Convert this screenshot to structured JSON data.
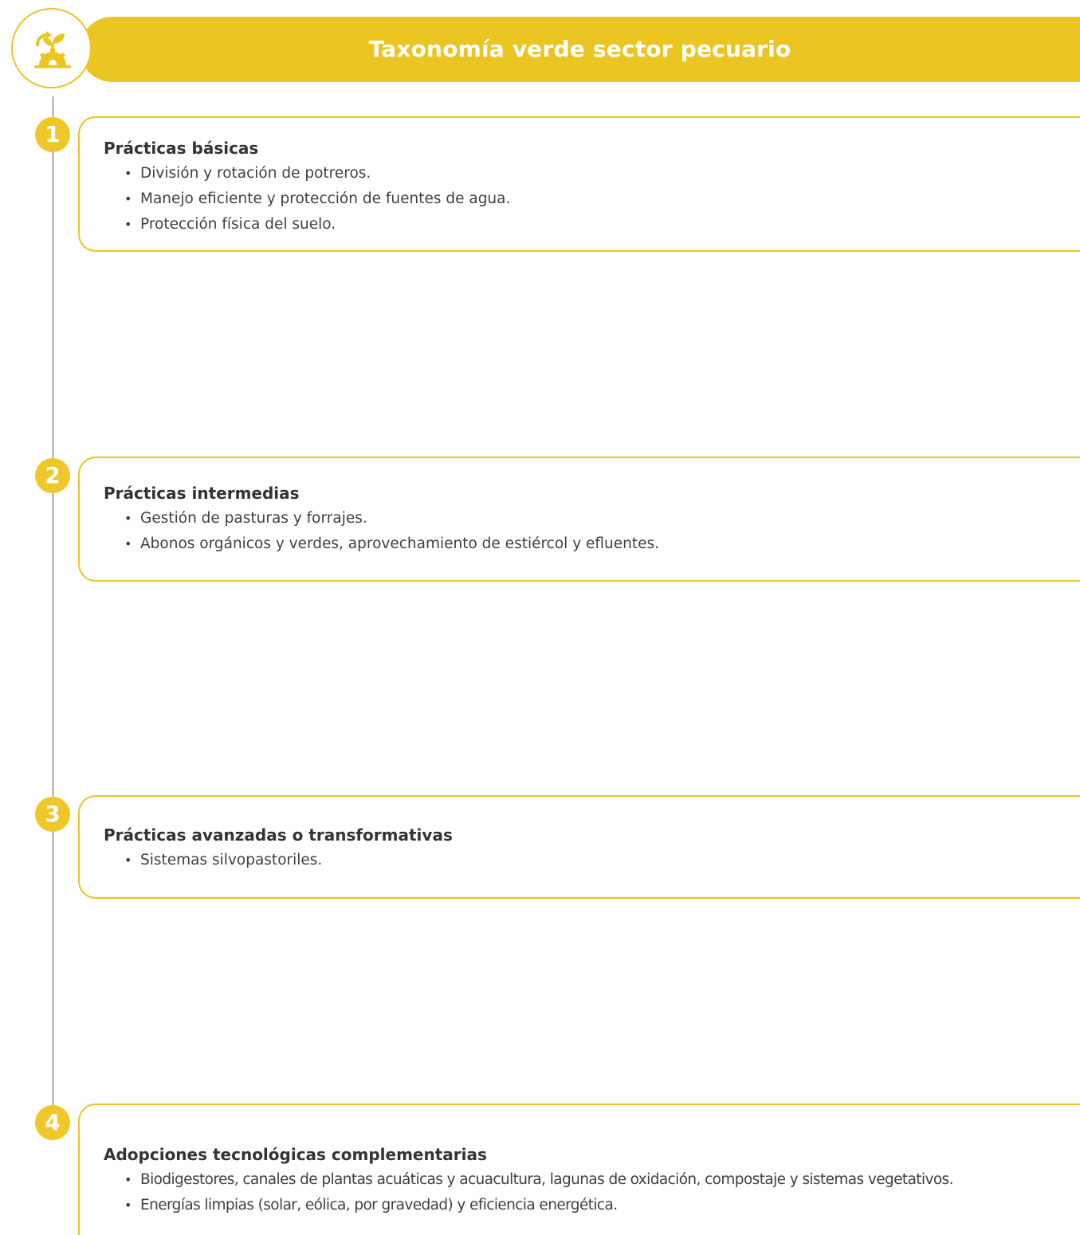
{
  "header": {
    "title": "Taxonomía verde sector pecuario"
  },
  "colors": {
    "accent": "#ebc522",
    "text": "#3f3f3f",
    "line": "#5c5c5c"
  },
  "steps": [
    {
      "number": "1",
      "title": "Prácticas básicas",
      "items": [
        "División y rotación de potreros.",
        "Manejo eficiente y protección de fuentes de agua.",
        "Protección física del suelo."
      ]
    },
    {
      "number": "2",
      "title": "Prácticas intermedias",
      "items": [
        "Gestión de pasturas y forrajes.",
        "Abonos orgánicos y verdes, aprovechamiento de estiércol y efluentes."
      ]
    },
    {
      "number": "3",
      "title": "Prácticas avanzadas o transformativas",
      "items": [
        "Sistemas silvopastoriles."
      ]
    },
    {
      "number": "4",
      "title": "Adopciones tecnológicas complementarias",
      "items": [
        "Biodigestores, canales de plantas acuáticas y acuacultura, lagunas de oxidación, compostaje y sistemas vegetativos.",
        "Energías limpias (solar, eólica, por gravedad) y eficiencia energética."
      ]
    }
  ]
}
